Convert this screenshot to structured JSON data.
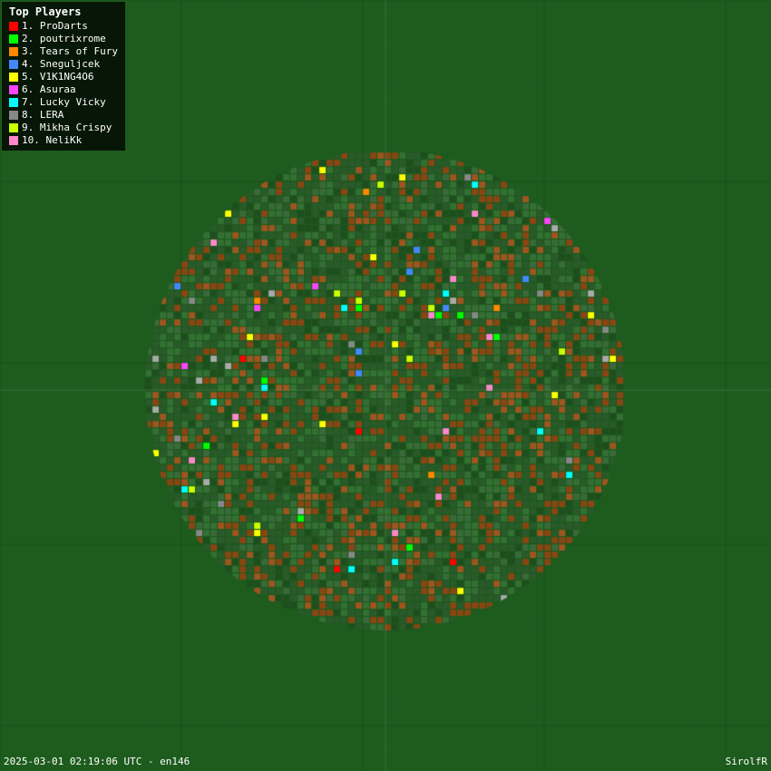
{
  "legend": {
    "title": "Top Players",
    "players": [
      {
        "rank": 1,
        "name": "ProDarts",
        "color": "#ff0000"
      },
      {
        "rank": 2,
        "name": "poutrixrome",
        "color": "#00ff00"
      },
      {
        "rank": 3,
        "name": "Tears of Fury",
        "color": "#ff8800"
      },
      {
        "rank": 4,
        "name": "Sneguljcek",
        "color": "#4488ff"
      },
      {
        "rank": 5,
        "name": "V1K1NG4O6",
        "color": "#ffff00"
      },
      {
        "rank": 6,
        "name": "Asuraa",
        "color": "#ff44ff"
      },
      {
        "rank": 7,
        "name": "Lucky Vicky",
        "color": "#00ffff"
      },
      {
        "rank": 8,
        "name": "LERA",
        "color": "#888888"
      },
      {
        "rank": 9,
        "name": "Mikha Crispy",
        "color": "#ccff00"
      },
      {
        "rank": 10,
        "name": "NeliKk",
        "color": "#ff88cc"
      }
    ]
  },
  "bottom_left": "2025-03-01 02:19:06 UTC - en146",
  "bottom_right": "SirolfR",
  "bg_color": "#1e5c1e",
  "grid_color": "#256325",
  "circle_color": "#2a5a2a"
}
